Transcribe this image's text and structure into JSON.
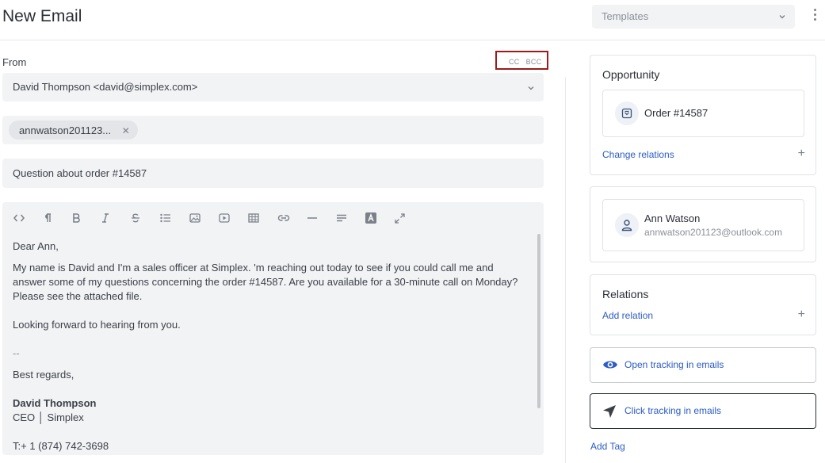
{
  "header": {
    "title": "New Email",
    "templates_placeholder": "Templates"
  },
  "compose": {
    "from_label": "From",
    "cc_label": "CC",
    "bcc_label": "BCC",
    "from_value": "David Thompson <david@simplex.com>",
    "to_chip": "annwatson201123...",
    "subject": "Question about order #14587",
    "body": {
      "greeting": "Dear Ann,",
      "para1": "My name is David and I'm a sales officer at Simplex. 'm reaching out today to see if you could call me and answer some of my questions concerning the order #14587. Are you available for a 30-minute call on Monday? Please see the attached file.",
      "para2": "Looking forward to hearing from you.",
      "separator": "--",
      "closing": "Best regards,",
      "sig_name": "David Thompson",
      "sig_title": "CEO │ Simplex",
      "sig_phone": "T:+ 1 (874) 742-3698"
    },
    "toolbar": [
      "code-icon",
      "paragraph-icon",
      "bold-icon",
      "italic-icon",
      "strikethrough-icon",
      "bullet-list-icon",
      "image-icon",
      "video-icon",
      "table-icon",
      "link-icon",
      "horizontal-rule-icon",
      "align-icon",
      "text-color-icon",
      "fullscreen-icon"
    ]
  },
  "sidebar": {
    "opportunity": {
      "title": "Opportunity",
      "item": "Order #14587",
      "action": "Change relations"
    },
    "contact": {
      "name": "Ann Watson",
      "email": "annwatson201123@outlook.com"
    },
    "relations": {
      "title": "Relations",
      "action": "Add relation"
    },
    "open_tracking": "Open tracking in emails",
    "click_tracking": "Click tracking in emails",
    "add_tag": "Add Tag"
  },
  "colors": {
    "accent": "#2c5cc5",
    "highlight_border": "#9b1c1c",
    "field_bg": "#f2f3f5"
  }
}
